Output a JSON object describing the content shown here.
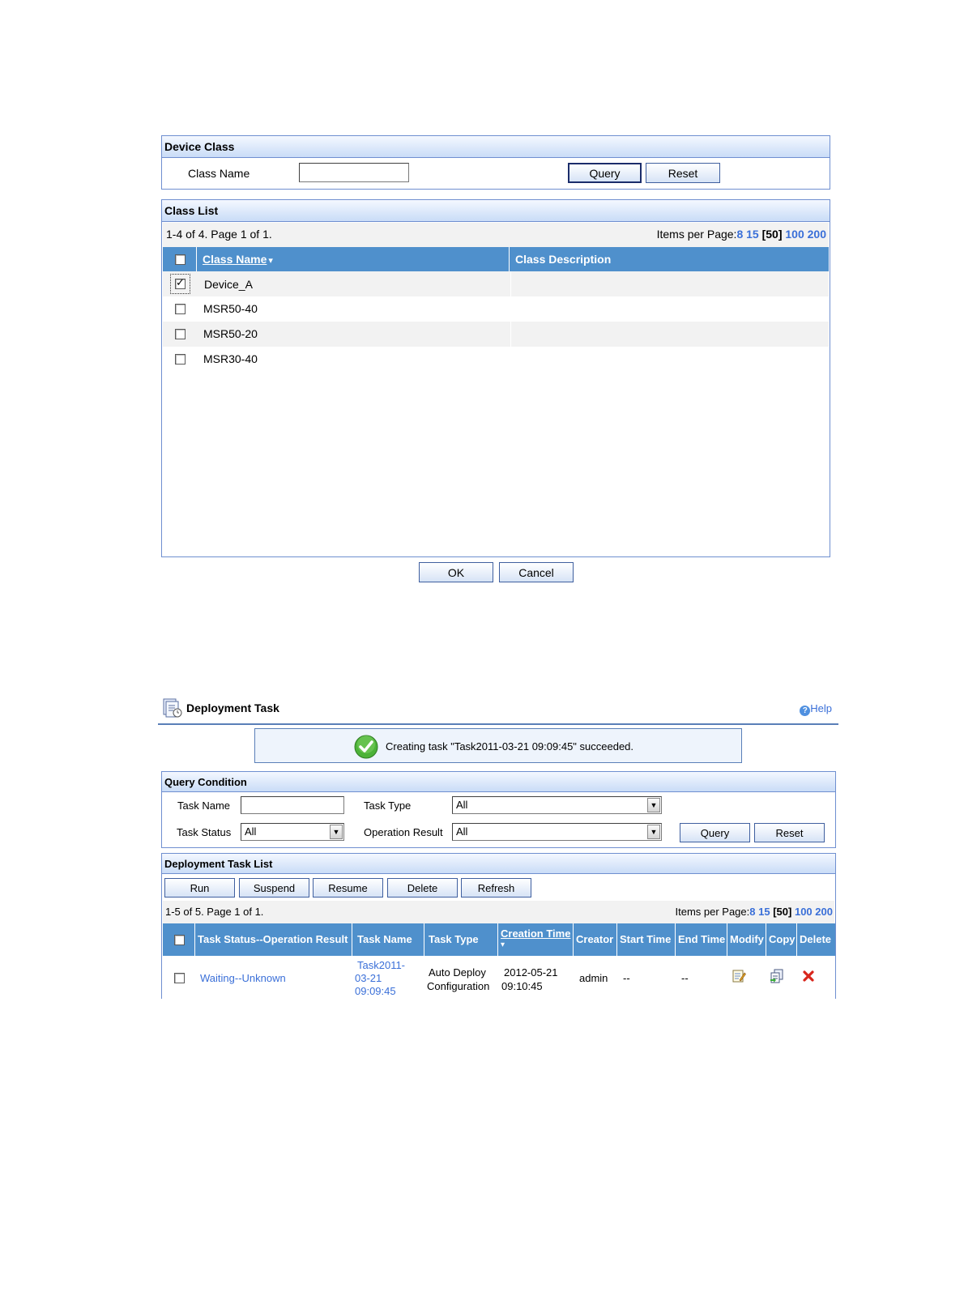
{
  "device_class": {
    "title": "Device Class",
    "class_name_label": "Class Name",
    "class_name_value": "",
    "query_label": "Query",
    "reset_label": "Reset"
  },
  "class_list": {
    "title": "Class List",
    "summary": "1-4 of 4. Page 1 of 1.",
    "items_per_page_label": "Items per Page:",
    "page_sizes": [
      "8",
      "15",
      "[50]",
      "100",
      "200"
    ],
    "columns": {
      "name": "Class Name",
      "description": "Class Description"
    },
    "sort_indicator": "▾",
    "rows": [
      {
        "name": "Device_A",
        "description": "",
        "checked": true
      },
      {
        "name": "MSR50-40",
        "description": "",
        "checked": false
      },
      {
        "name": "MSR50-20",
        "description": "",
        "checked": false
      },
      {
        "name": "MSR30-40",
        "description": "",
        "checked": false
      }
    ]
  },
  "dialog_buttons": {
    "ok": "OK",
    "cancel": "Cancel"
  },
  "deployment": {
    "title": "Deployment Task",
    "help": "Help",
    "success_message": "Creating task \"Task2011-03-21 09:09:45\" succeeded.",
    "query_condition": {
      "title": "Query Condition",
      "task_name_label": "Task Name",
      "task_name_value": "",
      "task_type_label": "Task Type",
      "task_type_value": "All",
      "task_status_label": "Task Status",
      "task_status_value": "All",
      "operation_result_label": "Operation Result",
      "operation_result_value": "All",
      "query_label": "Query",
      "reset_label": "Reset"
    },
    "task_list": {
      "title": "Deployment Task List",
      "actions": [
        "Run",
        "Suspend",
        "Resume",
        "Delete",
        "Refresh"
      ],
      "summary": "1-5 of 5. Page 1 of 1.",
      "items_per_page_label": "Items per Page:",
      "page_sizes": [
        "8",
        "15",
        "[50]",
        "100",
        "200"
      ],
      "columns": {
        "status": "Task Status--Operation Result",
        "name": "Task Name",
        "type": "Task Type",
        "created": "Creation Time",
        "creator": "Creator",
        "start": "Start Time",
        "end": "End Time",
        "modify": "Modify",
        "copy": "Copy",
        "delete": "Delete"
      },
      "sort_indicator": "▾",
      "rows": [
        {
          "status": "Waiting--Unknown",
          "name_line1": "Task2011-",
          "name_line2": "03-21",
          "name_line3": "09:09:45",
          "type_line1": "Auto Deploy",
          "type_line2": "Configuration",
          "created_line1": "2012-05-21",
          "created_line2": "09:10:45",
          "creator": "admin",
          "start": "--",
          "end": "--"
        }
      ]
    }
  }
}
